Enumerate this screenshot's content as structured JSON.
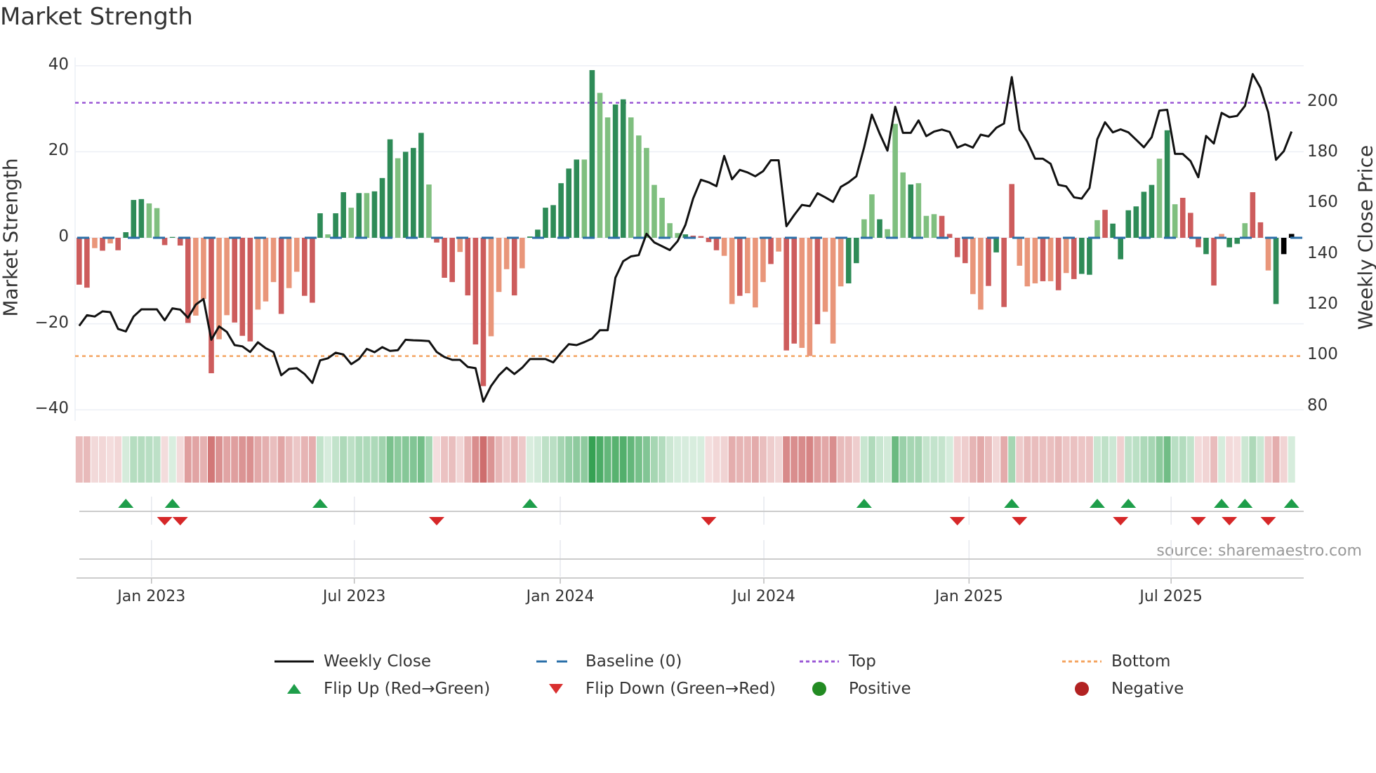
{
  "title": "Market Strength",
  "chart_data": {
    "type": "bar",
    "title": "Market Strength",
    "ylabel": "Market Strength",
    "y2label": "Weekly Close Price",
    "ylim": [
      -40,
      40
    ],
    "y2lim": [
      80,
      200
    ],
    "yticks": [
      "40",
      "20",
      "0",
      "−20",
      "−40"
    ],
    "ytick_values": [
      40,
      20,
      0,
      -20,
      -40
    ],
    "y2ticks": [
      "200",
      "180",
      "160",
      "140",
      "120",
      "100",
      "80"
    ],
    "y2tick_values": [
      200,
      180,
      160,
      140,
      120,
      100,
      80
    ],
    "xticks": [
      {
        "label": "Jan 2023",
        "week": 9.3
      },
      {
        "label": "Jul 2023",
        "week": 35.4
      },
      {
        "label": "Jan 2024",
        "week": 61.9
      },
      {
        "label": "Jul 2024",
        "week": 88.1
      },
      {
        "label": "Jan 2025",
        "week": 114.5
      },
      {
        "label": "Jul 2025",
        "week": 140.5
      }
    ],
    "top_level": 31.4,
    "bottom_level": -27.5,
    "strength": [
      -10.9,
      -11.6,
      -2.4,
      -3.0,
      -1.3,
      -2.9,
      1.3,
      8.8,
      9.0,
      8.0,
      6.9,
      -1.7,
      0.2,
      -1.8,
      -19.8,
      -18.1,
      -14.2,
      -31.5,
      -23.6,
      -18.0,
      -19.7,
      -22.8,
      -24.1,
      -16.7,
      -14.8,
      -10.3,
      -17.7,
      -11.7,
      -7.9,
      -13.5,
      -15.1,
      5.7,
      0.8,
      5.7,
      10.6,
      7.0,
      10.4,
      10.4,
      10.8,
      13.9,
      22.9,
      18.5,
      20.0,
      20.9,
      24.4,
      12.4,
      -1.1,
      -9.3,
      -10.3,
      -3.3,
      -13.4,
      -24.8,
      -34.5,
      -22.9,
      -12.6,
      -7.3,
      -13.4,
      -7.1,
      0.3,
      1.9,
      7.0,
      7.6,
      12.7,
      16.1,
      18.2,
      18.2,
      39.0,
      33.7,
      28.0,
      31.0,
      32.2,
      28.0,
      23.8,
      20.9,
      12.3,
      9.3,
      3.4,
      1.1,
      0.8,
      0.5,
      0.4,
      -1.0,
      -2.9,
      -4.2,
      -15.4,
      -13.5,
      -12.9,
      -16.2,
      -10.3,
      -6.1,
      -3.2,
      -26.2,
      -24.6,
      -25.6,
      -27.5,
      -20.1,
      -17.2,
      -24.6,
      -11.3,
      -10.6,
      -5.9,
      4.3,
      10.1,
      4.3,
      2.0,
      26.5,
      15.2,
      12.4,
      12.7,
      5.1,
      5.5,
      5.1,
      0.9,
      -4.5,
      -5.9,
      -13.1,
      -16.7,
      -11.2,
      -3.4,
      -16.1,
      12.5,
      -6.5,
      -11.3,
      -10.6,
      -10.1,
      -10.1,
      -12.2,
      -8.2,
      -9.6,
      -8.4,
      -8.6,
      4.1,
      6.5,
      3.3,
      -5.0,
      6.4,
      7.3,
      10.7,
      12.3,
      18.4,
      25.0,
      7.8,
      9.3,
      5.8,
      -2.2,
      -3.8,
      -11.1,
      0.9,
      -2.2,
      -1.4,
      3.4,
      10.6,
      3.6,
      -7.6,
      -15.4,
      -3.8,
      0.9
    ],
    "shade": "RRrRrRGGGggRGRRrrRrrRRRrrrRrrRRGgGGgGgGGGgGGGgRRRrRRRrrrRrGGGGGGGgGggGGgggggggGRRRRrrRrrrRrRRrrRrrrGGggGgggGgggRRRRrrRGRRrrrRrRrRGGgRGGGGGGgGgRRRGRrGGgRRrG",
    "close": [
      111.8,
      116.0,
      115.5,
      117.5,
      117.2,
      110.6,
      109.6,
      115.5,
      118.3,
      118.3,
      118.3,
      114.0,
      118.7,
      118.2,
      115.0,
      120.2,
      122.4,
      106.3,
      111.6,
      109.4,
      104.2,
      103.7,
      101.5,
      105.3,
      103.0,
      101.4,
      92.3,
      94.8,
      95.1,
      92.8,
      89.3,
      98.2,
      99.0,
      101.2,
      100.5,
      96.7,
      98.7,
      102.7,
      101.4,
      103.4,
      101.9,
      102.2,
      106.3,
      106.1,
      106.0,
      105.8,
      101.5,
      99.5,
      98.4,
      98.4,
      95.6,
      95.1,
      81.9,
      88.1,
      92.3,
      95.3,
      92.8,
      95.3,
      98.7,
      98.7,
      98.7,
      97.4,
      101.2,
      104.6,
      104.2,
      105.4,
      106.8,
      110.1,
      110.1,
      130.8,
      137.3,
      139.2,
      139.7,
      148.1,
      144.7,
      143.2,
      141.7,
      145.2,
      151.6,
      162.0,
      169.4,
      168.4,
      166.9,
      178.8,
      169.6,
      173.3,
      172.3,
      170.8,
      172.8,
      177.1,
      177.1,
      151.1,
      155.5,
      159.5,
      159.0,
      164.1,
      162.5,
      160.7,
      166.6,
      168.4,
      170.8,
      182.2,
      195.1,
      187.6,
      180.9,
      198.2,
      187.9,
      187.9,
      192.8,
      186.6,
      188.4,
      189.2,
      188.3,
      182.1,
      183.4,
      182.1,
      187.2,
      186.5,
      189.9,
      191.6,
      209.9,
      189.1,
      184.4,
      177.7,
      177.7,
      175.7,
      167.4,
      166.8,
      162.5,
      162.0,
      166.2,
      185.4,
      192.1,
      188.1,
      189.3,
      188.1,
      185.2,
      182.2,
      186.2,
      196.7,
      197.0,
      179.6,
      179.6,
      176.8,
      170.4,
      186.7,
      183.7,
      195.8,
      194.1,
      194.6,
      198.5,
      211.1,
      205.7,
      196.0,
      177.3,
      180.7,
      188.4
    ],
    "colors": {
      "positive_strong": "#2e8b57",
      "positive_weak": "#7fbf7f",
      "negative_strong": "#cd5c5c",
      "negative_weak": "#e9967a",
      "baseline": "#2a6fa8",
      "top": "#9b59d6",
      "bottom": "#f4a460",
      "flip_up": "#1e9e4a",
      "flip_down": "#d62728",
      "close": "#111111"
    },
    "legend": {
      "placement": "bottom",
      "items": [
        {
          "label": "Weekly Close",
          "symbol": "line"
        },
        {
          "label": "Baseline (0)",
          "symbol": "dash"
        },
        {
          "label": "Top",
          "symbol": "dot-purple"
        },
        {
          "label": "Bottom",
          "symbol": "dot-orange"
        },
        {
          "label": "Flip Up (Red→Green)",
          "symbol": "triangle-up"
        },
        {
          "label": "Flip Down (Green→Red)",
          "symbol": "triangle-down"
        },
        {
          "label": "Positive",
          "symbol": "circle-green"
        },
        {
          "label": "Negative",
          "symbol": "circle-red"
        }
      ]
    }
  },
  "source": "source: sharemaestro.com"
}
